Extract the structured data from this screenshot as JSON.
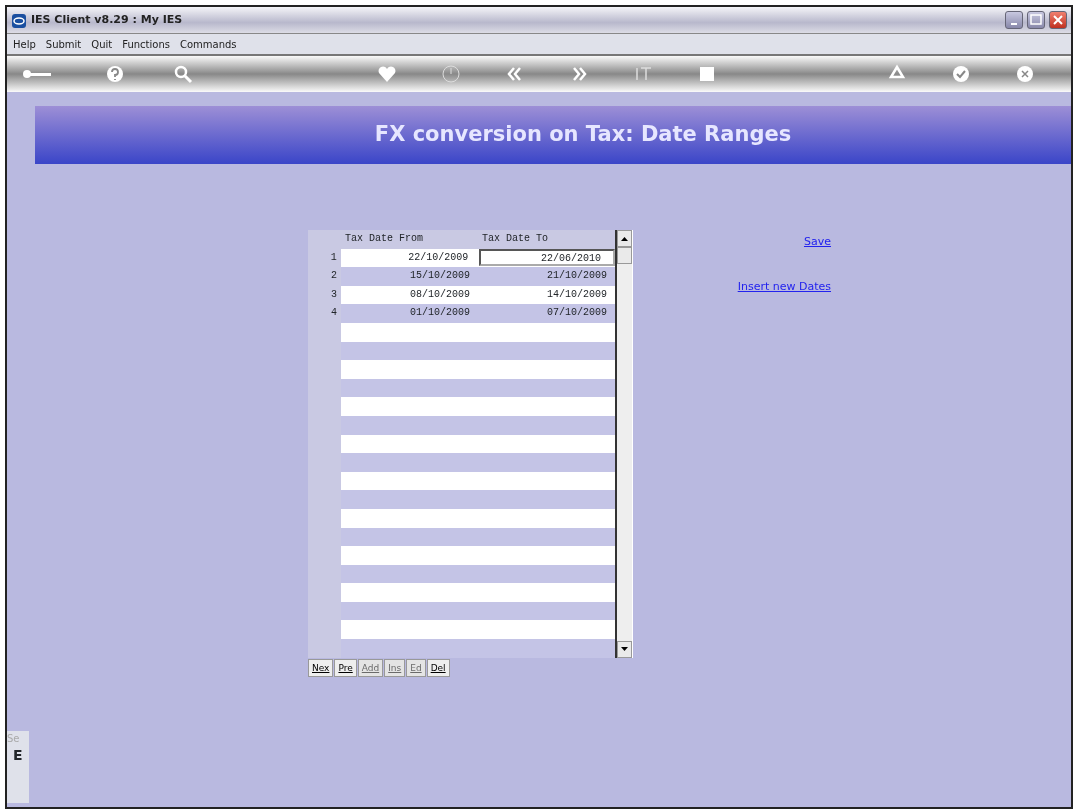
{
  "window": {
    "title": "IES Client v8.29 : My IES"
  },
  "menu": [
    "Help",
    "Submit",
    "Quit",
    "Functions",
    "Commands"
  ],
  "header": {
    "title": "FX conversion on Tax: Date Ranges"
  },
  "grid": {
    "columns": [
      "Tax Date From",
      "Tax Date To"
    ],
    "rows": [
      {
        "number": "1",
        "tax_date_from": "22/10/2009",
        "tax_date_to": "22/06/2010",
        "editing": true
      },
      {
        "number": "2",
        "tax_date_from": "15/10/2009",
        "tax_date_to": "21/10/2009",
        "editing": false
      },
      {
        "number": "3",
        "tax_date_from": "08/10/2009",
        "tax_date_to": "14/10/2009",
        "editing": false
      },
      {
        "number": "4",
        "tax_date_from": "01/10/2009",
        "tax_date_to": "07/10/2009",
        "editing": false
      }
    ],
    "buttons": [
      {
        "label": "Nex",
        "disabled": false
      },
      {
        "label": "Pre",
        "disabled": false
      },
      {
        "label": "Add",
        "disabled": true
      },
      {
        "label": "Ins",
        "disabled": true
      },
      {
        "label": "Ed",
        "disabled": true
      },
      {
        "label": "Del",
        "disabled": false
      }
    ]
  },
  "links": [
    "Save",
    "Insert new Dates"
  ],
  "side_panel": {
    "caption": "Se",
    "letter": "E"
  }
}
